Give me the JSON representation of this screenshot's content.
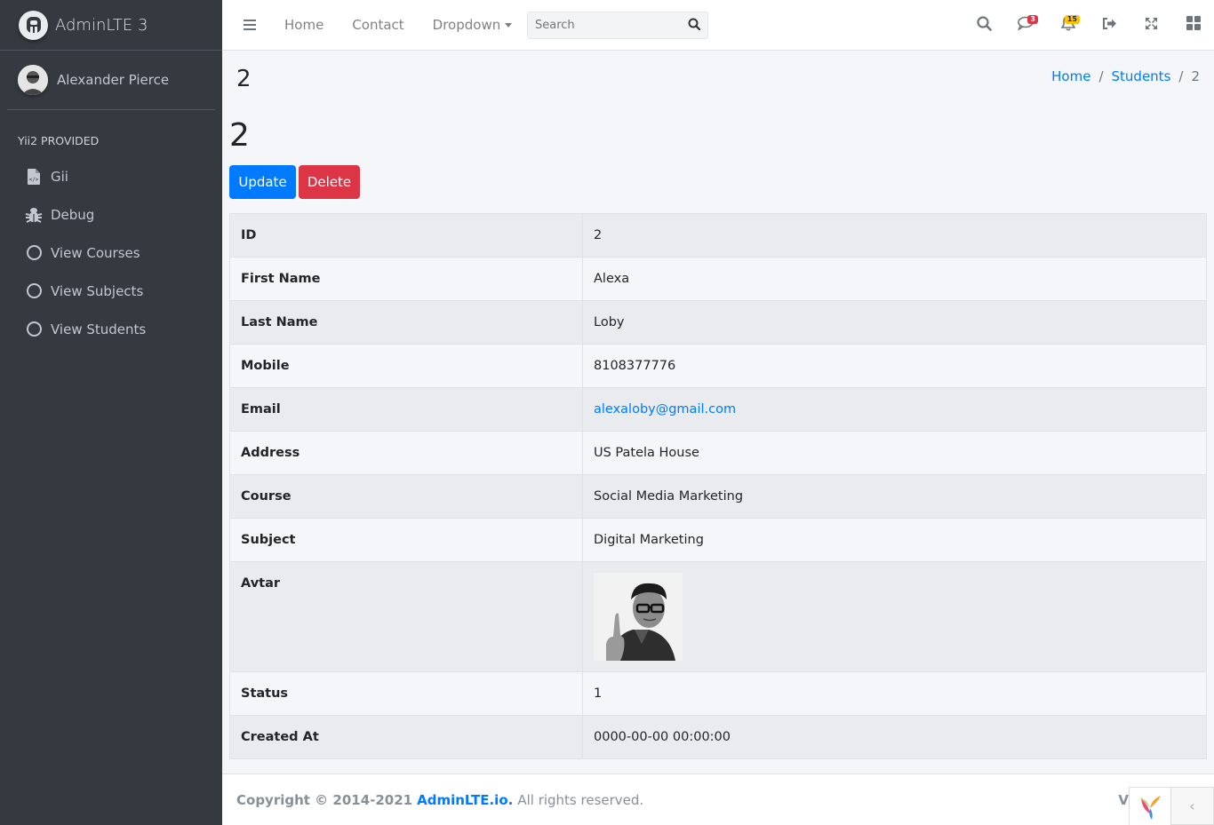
{
  "brand": {
    "title": "AdminLTE 3"
  },
  "sidebar": {
    "user_name": "Alexander Pierce",
    "header": "Yii2 PROVIDED",
    "items": [
      {
        "label": "Gii",
        "icon": "file-code-icon"
      },
      {
        "label": "Debug",
        "icon": "bug-icon"
      },
      {
        "label": "View Courses",
        "icon": "circle-icon"
      },
      {
        "label": "View Subjects",
        "icon": "circle-icon"
      },
      {
        "label": "View Students",
        "icon": "circle-icon"
      }
    ]
  },
  "navbar": {
    "links": [
      "Home",
      "Contact",
      "Dropdown"
    ],
    "search_placeholder": "Search",
    "messages_badge": "3",
    "notifications_badge": "15",
    "icons": [
      "search-icon",
      "comments-icon",
      "bell-icon",
      "sign-out-icon",
      "expand-icon",
      "th-large-icon"
    ]
  },
  "page": {
    "heading": "2",
    "title": "2",
    "breadcrumb": [
      "Home",
      "Students",
      "2"
    ],
    "buttons": {
      "update": "Update",
      "delete": "Delete"
    }
  },
  "details": [
    {
      "label": "ID",
      "value": "2"
    },
    {
      "label": "First Name",
      "value": "Alexa"
    },
    {
      "label": "Last Name",
      "value": "Loby"
    },
    {
      "label": "Mobile",
      "value": "8108377776"
    },
    {
      "label": "Email",
      "value": "alexaloby@gmail.com"
    },
    {
      "label": "Address",
      "value": "US Patela House"
    },
    {
      "label": "Course",
      "value": "Social Media Marketing"
    },
    {
      "label": "Subject",
      "value": "Digital Marketing"
    },
    {
      "label": "Avtar",
      "value": ""
    },
    {
      "label": "Status",
      "value": "1"
    },
    {
      "label": "Created At",
      "value": "0000-00-00 00:00:00"
    }
  ],
  "footer": {
    "copyright": "Copyright © 2014-2021",
    "link": "AdminLTE.io.",
    "rights": "All rights reserved.",
    "version_prefix": "V"
  },
  "colors": {
    "sidebar_bg": "#343a40",
    "primary": "#007bff",
    "danger": "#dc3545",
    "warning": "#ffc107"
  }
}
